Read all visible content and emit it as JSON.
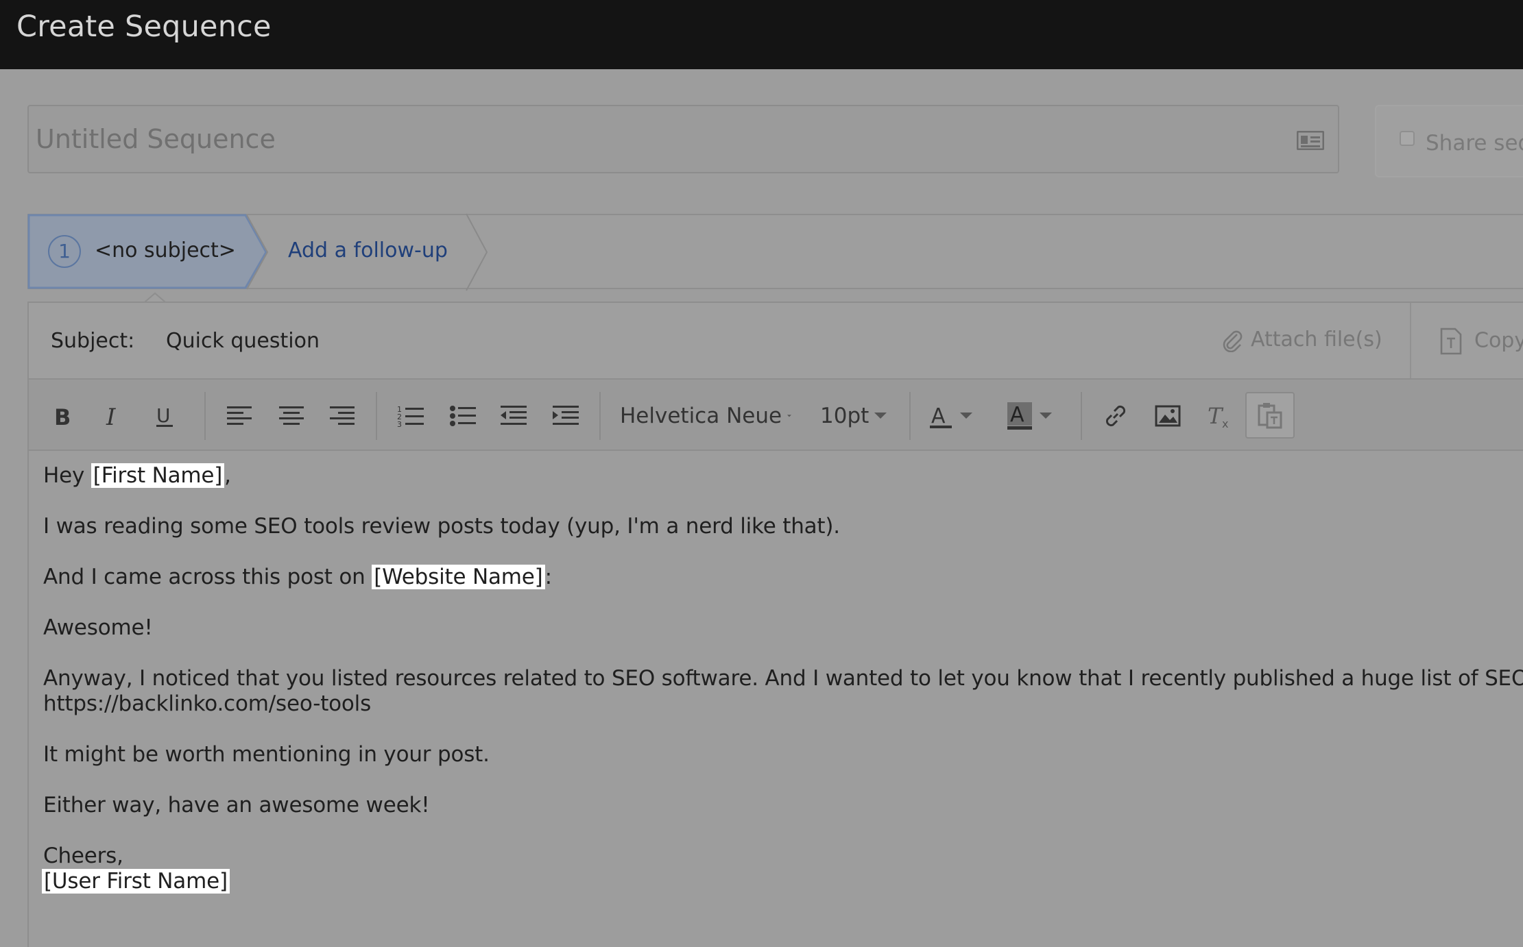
{
  "window": {
    "title": "Create Sequence"
  },
  "sequence": {
    "name_placeholder": "Untitled Sequence",
    "share_label": "Share seq"
  },
  "steps": [
    {
      "number": "1",
      "label": "<no subject>"
    },
    {
      "label": "Add a follow-up"
    }
  ],
  "email": {
    "subject_label": "Subject:",
    "subject_value": "Quick question",
    "attach_label": "Attach file(s)",
    "copy_label": "Copy"
  },
  "toolbar": {
    "font_family": "Helvetica Neue",
    "font_size": "10pt",
    "icons": [
      "bold",
      "italic",
      "underline",
      "align-left",
      "align-center",
      "align-right",
      "numbered-list",
      "bullet-list",
      "outdent",
      "indent",
      "text-color",
      "background-color",
      "link",
      "image",
      "clear-format",
      "paste"
    ]
  },
  "body": {
    "greeting_pre": "Hey",
    "greeting_tag": "[First Name]",
    "greeting_post": ",",
    "line2": "I was reading some SEO tools review posts today (yup, I'm a nerd like that).",
    "line3_pre": "And I came across this post on",
    "line3_tag": "[Website Name]",
    "line3_post": ":",
    "line4": "Awesome!",
    "line5a": "Anyway, I noticed that you listed resources related to SEO software. And I wanted to let you know that I recently published a huge list of SEO tools:",
    "line5b": "https://backlinko.com/seo-tools",
    "line6": "It might be worth mentioning in your post.",
    "line7": "Either way, have an awesome week!",
    "signoff": "Cheers,",
    "signature_tag": "[User First Name]"
  },
  "colors": {
    "topbar": "#141414",
    "overlay": "#9d9d9d",
    "link": "#1f3f7a",
    "active_step": "#8f9aab"
  }
}
